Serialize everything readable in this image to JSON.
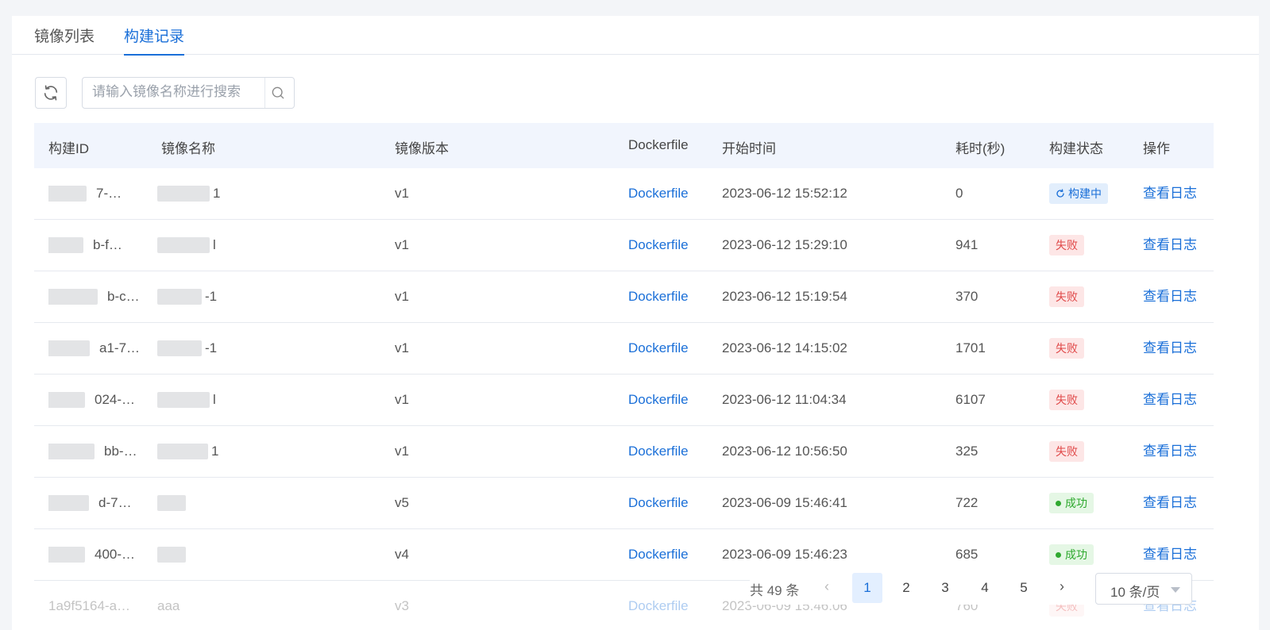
{
  "tabs": [
    {
      "label": "镜像列表",
      "active": false
    },
    {
      "label": "构建记录",
      "active": true
    }
  ],
  "search": {
    "placeholder": "请输入镜像名称进行搜索",
    "value": ""
  },
  "icons": {
    "refresh": "refresh-icon",
    "search": "search-icon"
  },
  "table": {
    "headers": [
      "构建ID",
      "镜像名称",
      "镜像版本",
      "Dockerfile",
      "开始时间",
      "耗时(秒)",
      "构建状态",
      "操作"
    ],
    "rows": [
      {
        "id": "7-…",
        "name": "1",
        "version": "v1",
        "dockerfile": "Dockerfile",
        "start": "2023-06-12 15:52:12",
        "duration": "0",
        "status": "构建中",
        "status_type": "running",
        "action": "查看日志"
      },
      {
        "id": "b-f…",
        "name": "l",
        "version": "v1",
        "dockerfile": "Dockerfile",
        "start": "2023-06-12 15:29:10",
        "duration": "941",
        "status": "失败",
        "status_type": "fail",
        "action": "查看日志"
      },
      {
        "id": "b-c…",
        "name": "-1",
        "version": "v1",
        "dockerfile": "Dockerfile",
        "start": "2023-06-12 15:19:54",
        "duration": "370",
        "status": "失败",
        "status_type": "fail",
        "action": "查看日志"
      },
      {
        "id": "a1-7…",
        "name": "-1",
        "version": "v1",
        "dockerfile": "Dockerfile",
        "start": "2023-06-12 14:15:02",
        "duration": "1701",
        "status": "失败",
        "status_type": "fail",
        "action": "查看日志"
      },
      {
        "id": "024-…",
        "name": "l",
        "version": "v1",
        "dockerfile": "Dockerfile",
        "start": "2023-06-12 11:04:34",
        "duration": "6107",
        "status": "失败",
        "status_type": "fail",
        "action": "查看日志"
      },
      {
        "id": "bb-…",
        "name": "1",
        "version": "v1",
        "dockerfile": "Dockerfile",
        "start": "2023-06-12 10:56:50",
        "duration": "325",
        "status": "失败",
        "status_type": "fail",
        "action": "查看日志"
      },
      {
        "id": "d-7…",
        "name": "",
        "version": "v5",
        "dockerfile": "Dockerfile",
        "start": "2023-06-09 15:46:41",
        "duration": "722",
        "status": "成功",
        "status_type": "success",
        "action": "查看日志"
      },
      {
        "id": "400-…",
        "name": "",
        "version": "v4",
        "dockerfile": "Dockerfile",
        "start": "2023-06-09 15:46:23",
        "duration": "685",
        "status": "成功",
        "status_type": "success",
        "action": "查看日志"
      },
      {
        "id": "1a9f5164-a…",
        "name": "aaa",
        "version": "v3",
        "dockerfile": "Dockerfile",
        "start": "2023-06-09 15:46:06",
        "duration": "760",
        "status": "失败",
        "status_type": "fail",
        "action": "查看日志"
      }
    ]
  },
  "pagination": {
    "total_label": "共 49 条",
    "prev": "‹",
    "next": "›",
    "pages": [
      "1",
      "2",
      "3",
      "4",
      "5"
    ],
    "current": "1",
    "page_size_label": "10 条/页"
  },
  "colors": {
    "accent": "#1a6fd8",
    "fail": "#e04848",
    "success": "#2fa92f"
  }
}
